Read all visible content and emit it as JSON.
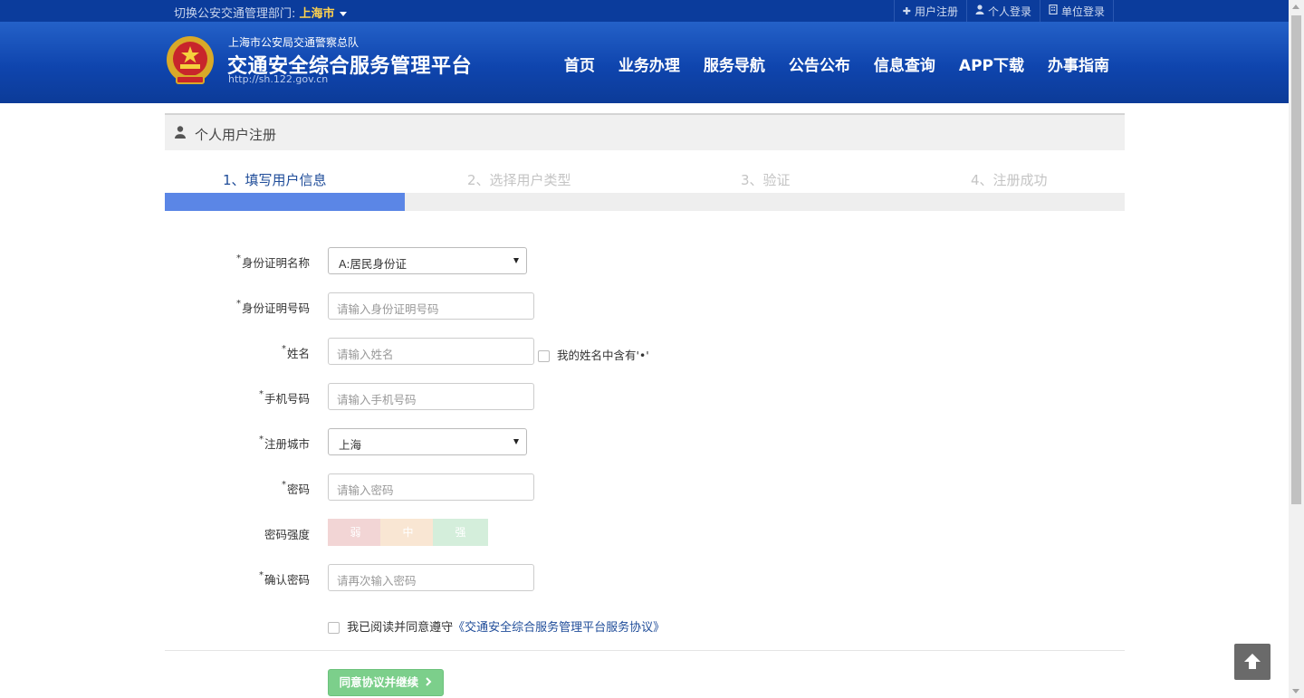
{
  "topbar": {
    "switch_label": "切换公安交通管理部门:",
    "city": "上海市",
    "links": [
      {
        "icon": "plus-icon",
        "label": "用户注册"
      },
      {
        "icon": "user-icon",
        "label": "个人登录"
      },
      {
        "icon": "building-icon",
        "label": "单位登录"
      }
    ]
  },
  "header": {
    "subtitle": "上海市公安局交通警察总队",
    "title": "交通安全综合服务管理平台",
    "url": "http://sh.122.gov.cn",
    "nav": [
      "首页",
      "业务办理",
      "服务导航",
      "公告公布",
      "信息查询",
      "APP下载",
      "办事指南"
    ]
  },
  "panel": {
    "title": "个人用户注册"
  },
  "steps": [
    "1、填写用户信息",
    "2、选择用户类型",
    "3、验证",
    "4、注册成功"
  ],
  "progress": {
    "current_step": 1,
    "total_steps": 4,
    "fraction": 0.25
  },
  "form": {
    "id_type": {
      "label": "身份证明名称",
      "value": "A:居民身份证"
    },
    "id_number": {
      "label": "身份证明号码",
      "placeholder": "请输入身份证明号码"
    },
    "name": {
      "label": "姓名",
      "placeholder": "请输入姓名",
      "dot_option": "我的姓名中含有'•'"
    },
    "phone": {
      "label": "手机号码",
      "placeholder": "请输入手机号码"
    },
    "city": {
      "label": "注册城市",
      "value": "上海"
    },
    "password": {
      "label": "密码",
      "placeholder": "请输入密码"
    },
    "strength": {
      "label": "密码强度",
      "levels": [
        "弱",
        "中",
        "强"
      ]
    },
    "confirm": {
      "label": "确认密码",
      "placeholder": "请再次输入密码"
    }
  },
  "agreement": {
    "prefix": "我已阅读并同意遵守",
    "link": "《交通安全综合服务管理平台服务协议》"
  },
  "submit_label": "同意协议并继续",
  "colors": {
    "topbar": "#0b3c9c",
    "header": "#1550b8",
    "accent": "#5b86e6",
    "submit": "#7ccf8b",
    "weak": "#f2d5d5",
    "medium": "#f9e6d3",
    "strong": "#d4eedb"
  }
}
